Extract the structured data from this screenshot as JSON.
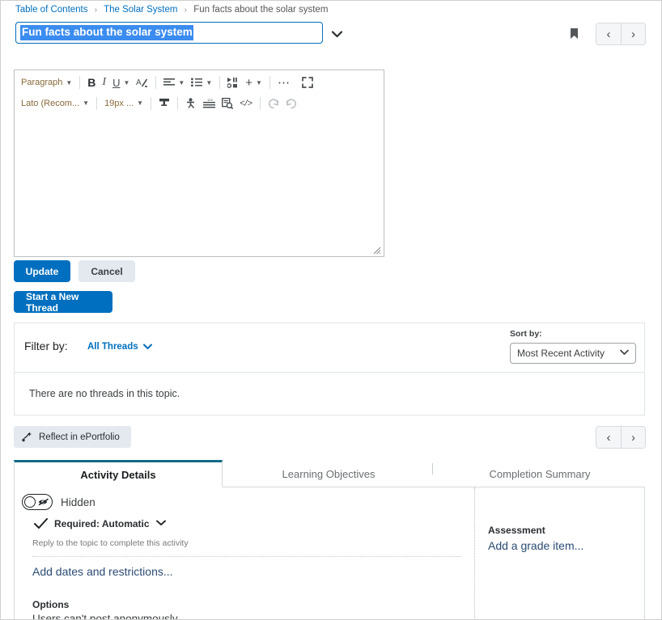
{
  "breadcrumb": {
    "items": [
      {
        "label": "Table of Contents"
      },
      {
        "label": "The Solar System"
      },
      {
        "label": "Fun facts about the solar system"
      }
    ],
    "separator": "›"
  },
  "title": {
    "value": "Fun facts about the solar system",
    "selected": true,
    "caret_icon": "chevron-down-icon"
  },
  "topbar": {
    "bookmark_icon": "bookmark-icon",
    "prev_label": "‹",
    "next_label": "›"
  },
  "editor": {
    "toolbar_row1": [
      {
        "name": "paragraph-format-select",
        "label": "Paragraph",
        "type": "select"
      },
      {
        "name": "bold-button",
        "label": "B",
        "type": "icon"
      },
      {
        "name": "italic-button",
        "label": "I",
        "type": "icon"
      },
      {
        "name": "underline-button",
        "label": "U",
        "type": "icon-split"
      },
      {
        "name": "text-color-button",
        "label": "A",
        "type": "icon"
      },
      {
        "name": "align-button",
        "label": "align",
        "type": "icon-split"
      },
      {
        "name": "list-button",
        "label": "list",
        "type": "icon-split"
      },
      {
        "name": "insert-media-button",
        "label": "media",
        "type": "icon"
      },
      {
        "name": "insert-button",
        "label": "+",
        "type": "icon-split"
      },
      {
        "name": "more-options-button",
        "label": "⋯",
        "type": "icon"
      },
      {
        "name": "fullscreen-button",
        "label": "fullscreen",
        "type": "icon"
      }
    ],
    "toolbar_row2": [
      {
        "name": "font-family-select",
        "label": "Lato (Recom...",
        "type": "select"
      },
      {
        "name": "font-size-select",
        "label": "19px ...",
        "type": "select"
      },
      {
        "name": "format-painter-button",
        "label": "format-painter",
        "type": "icon"
      },
      {
        "name": "accessibility-checker-button",
        "label": "accessibility",
        "type": "icon"
      },
      {
        "name": "word-count-button",
        "label": "word-count",
        "type": "icon"
      },
      {
        "name": "preview-button",
        "label": "preview",
        "type": "icon"
      },
      {
        "name": "html-source-button",
        "label": "</>",
        "type": "icon"
      },
      {
        "name": "undo-button",
        "label": "undo",
        "type": "icon"
      },
      {
        "name": "redo-button",
        "label": "redo",
        "type": "icon"
      }
    ],
    "content": "",
    "resize_grip": "resize-grip-icon"
  },
  "actions": {
    "update_label": "Update",
    "cancel_label": "Cancel",
    "new_thread_label": "Start a New Thread"
  },
  "filter": {
    "filter_label": "Filter by:",
    "filter_value": "All Threads",
    "sort_label": "Sort by:",
    "sort_value": "Most Recent Activity",
    "empty_message": "There are no threads in this topic."
  },
  "eportfolio": {
    "label": "Reflect in ePortfolio",
    "icon": "eportfolio-icon"
  },
  "tabs": [
    {
      "name": "activity-details",
      "label": "Activity Details",
      "active": true
    },
    {
      "name": "learning-objectives",
      "label": "Learning Objectives",
      "active": false
    },
    {
      "name": "completion-summary",
      "label": "Completion Summary",
      "active": false
    }
  ],
  "details": {
    "visibility_label": "Hidden",
    "visibility_state": "off",
    "required_label": "Required: Automatic",
    "helper_text": "Reply to the topic to complete this activity",
    "dates_link": "Add dates and restrictions...",
    "options_heading": "Options",
    "options_text": "Users can't post anonymously",
    "assessment_heading": "Assessment",
    "assessment_link": "Add a grade item..."
  },
  "colors": {
    "accent": "#006fbf",
    "tab_active": "#136a8a",
    "selection": "#3b8cf0",
    "link": "#2a4b73"
  }
}
